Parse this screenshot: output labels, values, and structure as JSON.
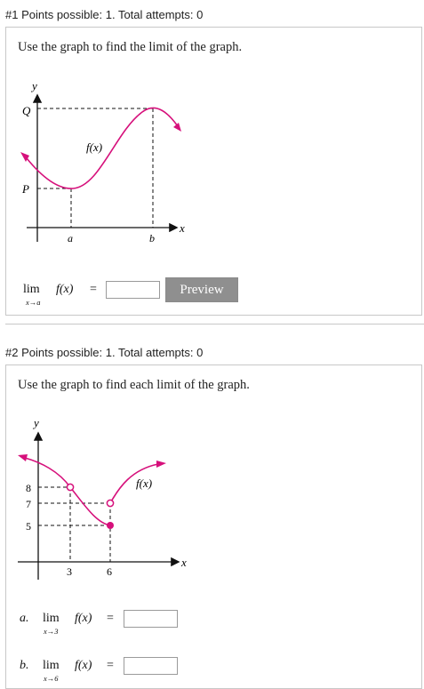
{
  "q1": {
    "header": "#1 Points possible: 1. Total attempts: 0",
    "prompt": "Use the graph to find the limit of the graph.",
    "graph": {
      "axis_y": "y",
      "axis_x": "x",
      "label_Q": "Q",
      "label_P": "P",
      "label_a": "a",
      "label_b": "b",
      "curve_label": "f(x)"
    },
    "answer": {
      "lim": "lim",
      "sub": "x→a",
      "expr": "f(x)",
      "equals": "=",
      "value": ""
    },
    "preview_label": "Preview"
  },
  "q2": {
    "header": "#2 Points possible: 1. Total attempts: 0",
    "prompt": "Use the graph to find each limit of the graph.",
    "graph": {
      "axis_y": "y",
      "axis_x": "x",
      "y8": "8",
      "y7": "7",
      "y5": "5",
      "x3": "3",
      "x6": "6",
      "curve_label": "f(x)"
    },
    "parts": [
      {
        "letter": "a.",
        "lim": "lim",
        "sub": "x→3",
        "expr": "f(x)",
        "equals": "=",
        "value": ""
      },
      {
        "letter": "b.",
        "lim": "lim",
        "sub": "x→6",
        "expr": "f(x)",
        "equals": "=",
        "value": ""
      }
    ]
  },
  "colors": {
    "curve": "#d6107b",
    "button": "#8f8f8f",
    "border": "#c8c8c8"
  }
}
